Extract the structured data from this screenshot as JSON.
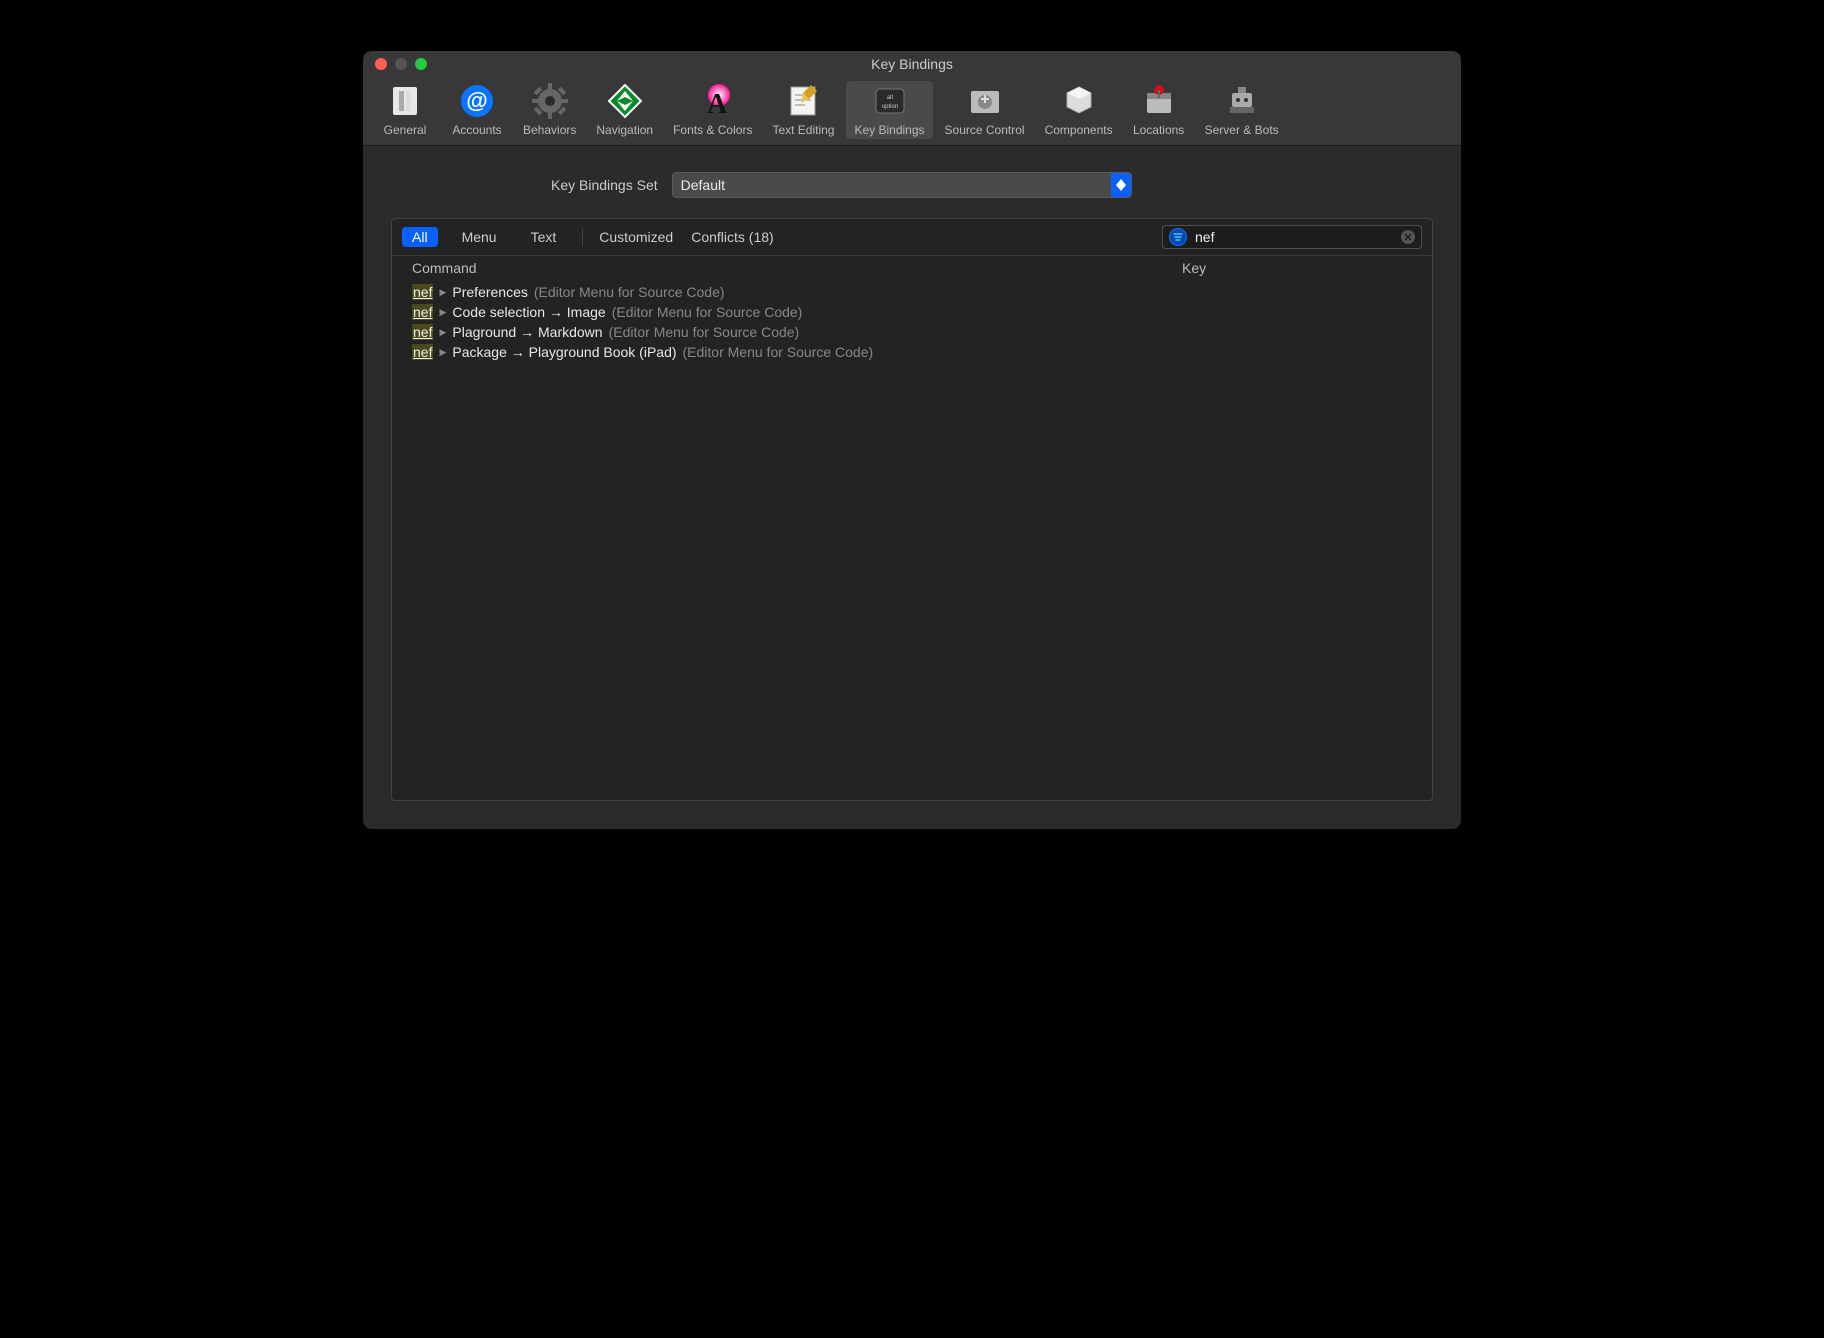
{
  "window": {
    "title": "Key Bindings"
  },
  "toolbar": {
    "items": [
      {
        "label": "General"
      },
      {
        "label": "Accounts"
      },
      {
        "label": "Behaviors"
      },
      {
        "label": "Navigation"
      },
      {
        "label": "Fonts & Colors"
      },
      {
        "label": "Text Editing"
      },
      {
        "label": "Key Bindings"
      },
      {
        "label": "Source Control"
      },
      {
        "label": "Components"
      },
      {
        "label": "Locations"
      },
      {
        "label": "Server & Bots"
      }
    ]
  },
  "set_row": {
    "label": "Key Bindings Set",
    "value": "Default"
  },
  "tabs": {
    "all": "All",
    "menu": "Menu",
    "text": "Text",
    "customized": "Customized",
    "conflicts": "Conflicts (18)"
  },
  "search": {
    "value": "nef"
  },
  "columns": {
    "command": "Command",
    "key": "Key"
  },
  "rows": [
    {
      "hl": "nef",
      "main": "Preferences",
      "suffix": "(Editor Menu for Source Code)"
    },
    {
      "hl": "nef",
      "main": "Code selection → Image",
      "suffix": "(Editor Menu for Source Code)"
    },
    {
      "hl": "nef",
      "main": "Plaground → Markdown",
      "suffix": "(Editor Menu for Source Code)"
    },
    {
      "hl": "nef",
      "main": "Package   → Playground Book (iPad)",
      "suffix": "(Editor Menu for Source Code)"
    }
  ]
}
